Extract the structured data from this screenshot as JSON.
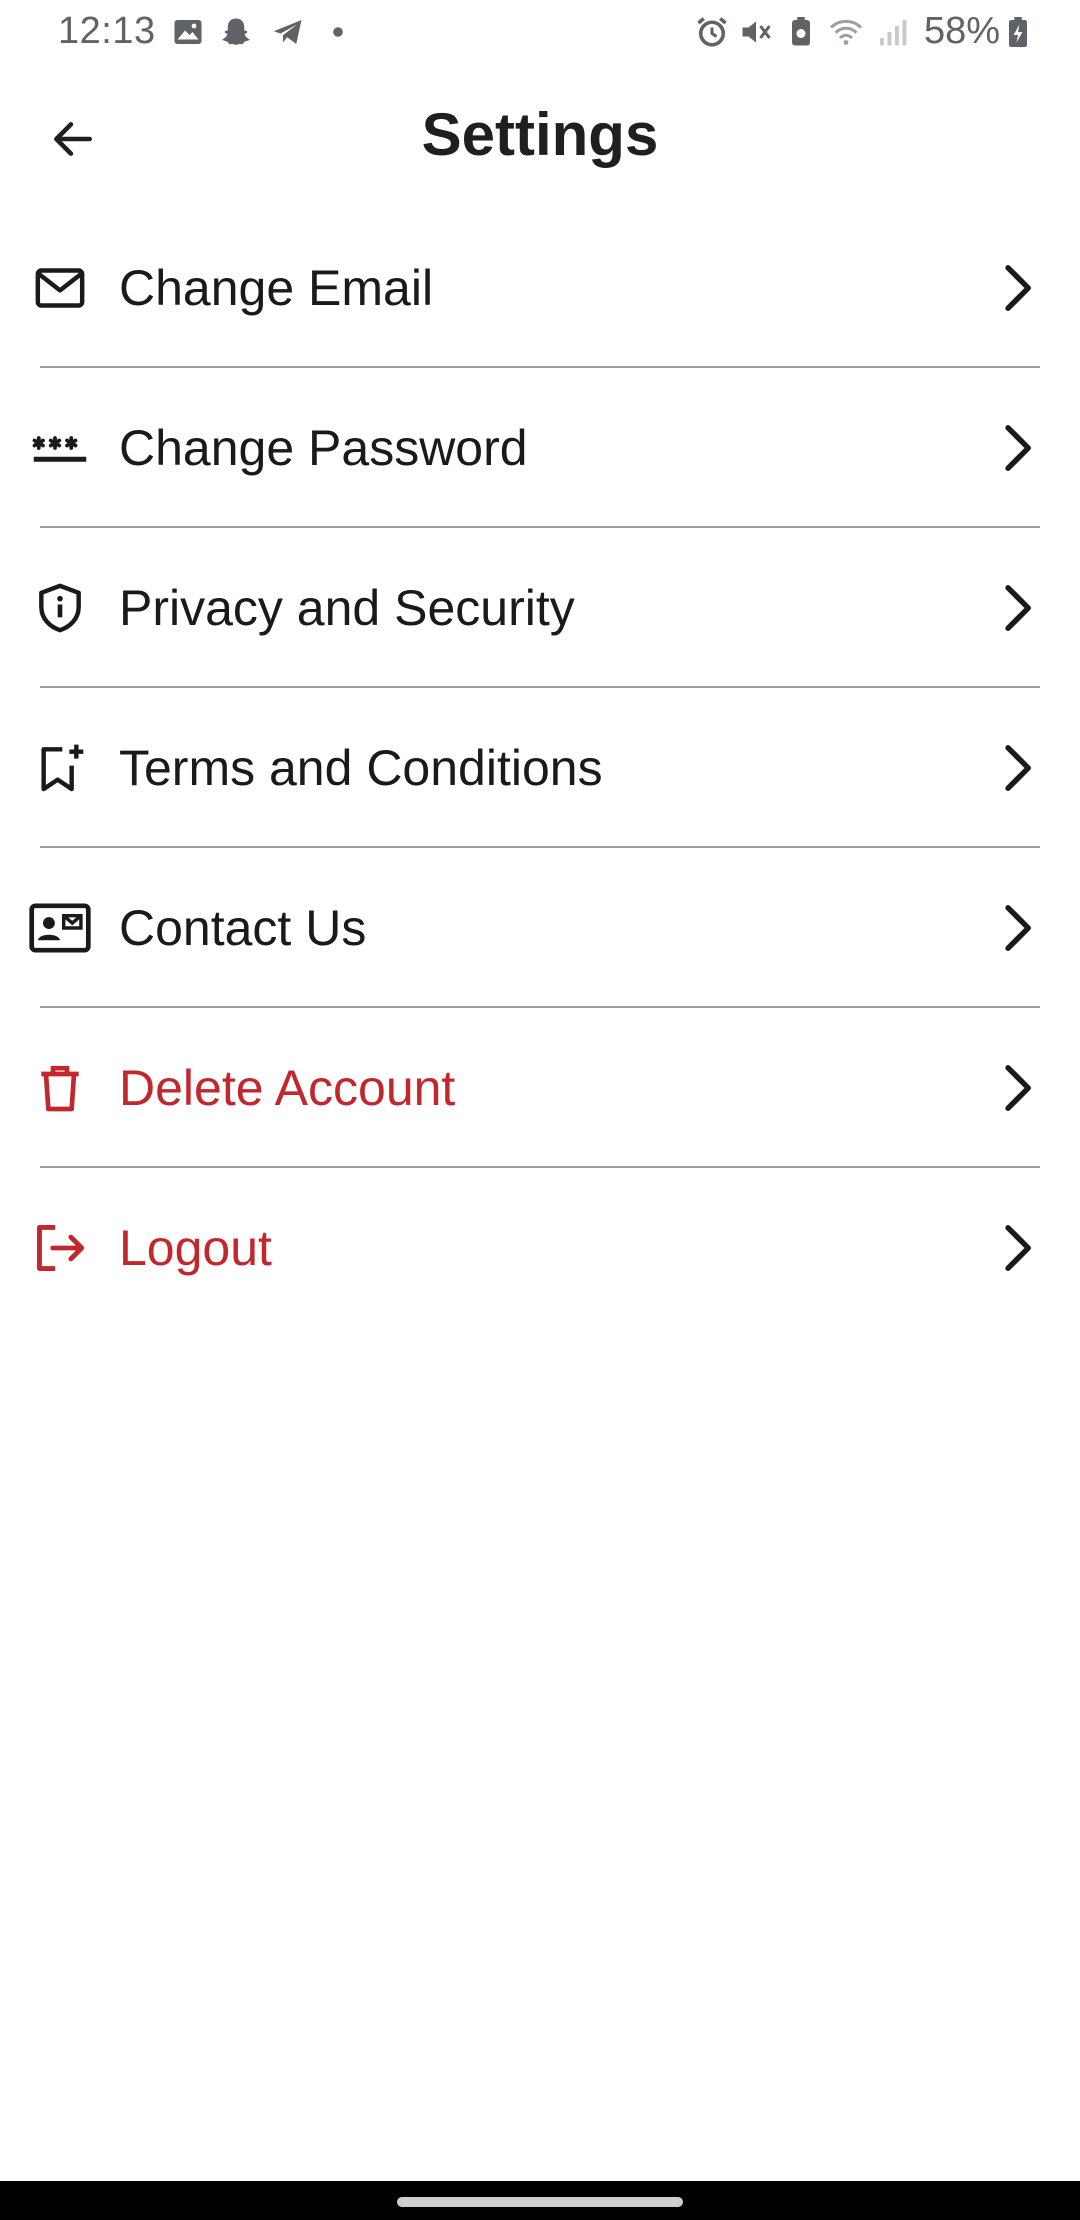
{
  "status_bar": {
    "time": "12:13",
    "battery_percent": "58%",
    "icons": [
      "gallery-icon",
      "snapchat-icon",
      "telegram-icon",
      "dot-icon",
      "alarm-icon",
      "vibrate-mute-icon",
      "battery-saver-icon",
      "wifi-icon",
      "signal-icon",
      "battery-charging-icon"
    ]
  },
  "header": {
    "title": "Settings",
    "back_icon": "arrow-left-icon"
  },
  "settings": {
    "items": [
      {
        "label": "Change Email",
        "icon": "mail-icon",
        "danger": false
      },
      {
        "label": "Change Password",
        "icon": "password-icon",
        "danger": false
      },
      {
        "label": "Privacy and Security",
        "icon": "shield-icon",
        "danger": false
      },
      {
        "label": "Terms and Conditions",
        "icon": "bookmark-add-icon",
        "danger": false
      },
      {
        "label": "Contact Us",
        "icon": "contact-card-icon",
        "danger": false
      },
      {
        "label": "Delete Account",
        "icon": "trash-icon",
        "danger": true
      },
      {
        "label": "Logout",
        "icon": "logout-icon",
        "danger": true
      }
    ]
  },
  "colors": {
    "danger": "#c2272d",
    "text": "#1a1a1a",
    "divider": "#9e9e9e",
    "status_text": "#5f6368"
  }
}
